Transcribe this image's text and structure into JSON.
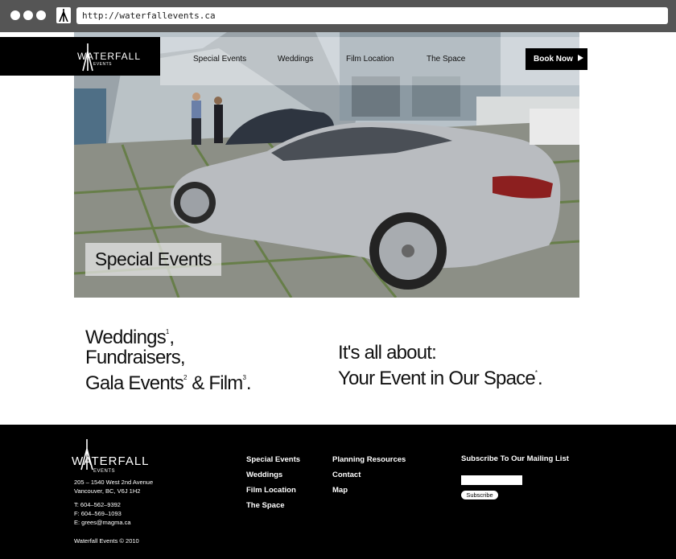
{
  "browser": {
    "url": "http://waterfallevents.ca"
  },
  "brand": {
    "logo_text": "WATERFALL",
    "logo_sub": "EVENTS"
  },
  "nav": {
    "items": [
      {
        "label": "Special Events"
      },
      {
        "label": "Weddings"
      },
      {
        "label": "Film Location"
      },
      {
        "label": "The Space"
      }
    ],
    "book_label": "Book Now"
  },
  "hero": {
    "caption": "Special Events"
  },
  "taglines": {
    "left": {
      "line1": "Weddings",
      "sup1": "1",
      "line1_tail": ",",
      "line2": "Fundraisers,",
      "line3a": "Gala Events",
      "sup2": "2",
      "line3b": " & Film",
      "sup3": "3",
      "line3_tail": "."
    },
    "right": {
      "line1": "It's all about:",
      "line2": "Your Event in Our Space",
      "sup": "*",
      "tail": "."
    }
  },
  "footer": {
    "address_line1": "205 – 1540 West 2nd Avenue",
    "address_line2": "Vancouver, BC, V6J 1H2",
    "phone": "T: 604–562–9392",
    "fax": "F: 604–569–1093",
    "email": "E: grees@magma.ca",
    "copyright": "Waterfall Events  ©  2010",
    "col1": [
      "Special Events",
      "Weddings",
      "Film Location",
      "The Space"
    ],
    "col2": [
      "Planning Resources",
      "Contact",
      "Map"
    ],
    "subscribe_title": "Subscribe To Our Mailing List",
    "subscribe_button": "Subscribe"
  }
}
